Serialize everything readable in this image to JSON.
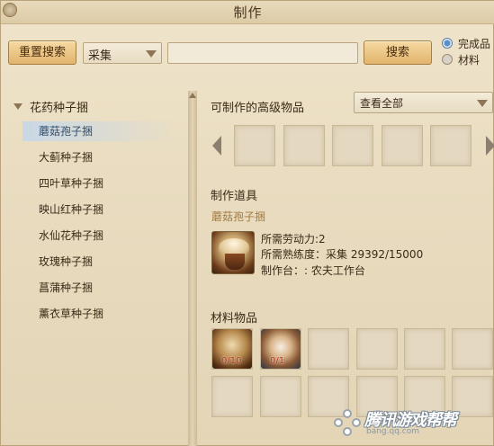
{
  "window": {
    "title": "制作"
  },
  "toolbar": {
    "reset_label": "重置搜索",
    "category_select": "采集",
    "search_placeholder": "",
    "search_label": "搜索",
    "radio_finished": "完成品",
    "radio_material": "材料",
    "selected_radio": "完成品"
  },
  "sidebar": {
    "category": "花药种子捆",
    "items": [
      {
        "label": "蘑菇孢子捆",
        "selected": true
      },
      {
        "label": "大蓟种子捆",
        "selected": false
      },
      {
        "label": "四叶草种子捆",
        "selected": false
      },
      {
        "label": "映山红种子捆",
        "selected": false
      },
      {
        "label": "水仙花种子捆",
        "selected": false
      },
      {
        "label": "玫瑰种子捆",
        "selected": false
      },
      {
        "label": "菖蒲种子捆",
        "selected": false
      },
      {
        "label": "薰衣草种子捆",
        "selected": false
      }
    ]
  },
  "advanced": {
    "label": "可制作的高级物品",
    "view_select": "查看全部"
  },
  "tool": {
    "label": "制作道具",
    "item_name": "蘑菇孢子捆",
    "labor": "所需劳动力:2",
    "proficiency": "所需熟练度：采集 29392/15000",
    "workbench": "制作台：: 农夫工作台"
  },
  "materials": {
    "label": "材料物品",
    "items": [
      {
        "icon": "mushroom-icon",
        "count": "0/10"
      },
      {
        "icon": "spore-bag-icon",
        "count": "0/1"
      }
    ]
  },
  "watermark": {
    "text": "腾讯游戏帮帮",
    "url": "bang.qq.com"
  },
  "colors": {
    "accent_button": "#e1b46c",
    "selected_row": "#c9d8e6",
    "item_name": "#a37a3c",
    "count_red": "#c0361c"
  }
}
